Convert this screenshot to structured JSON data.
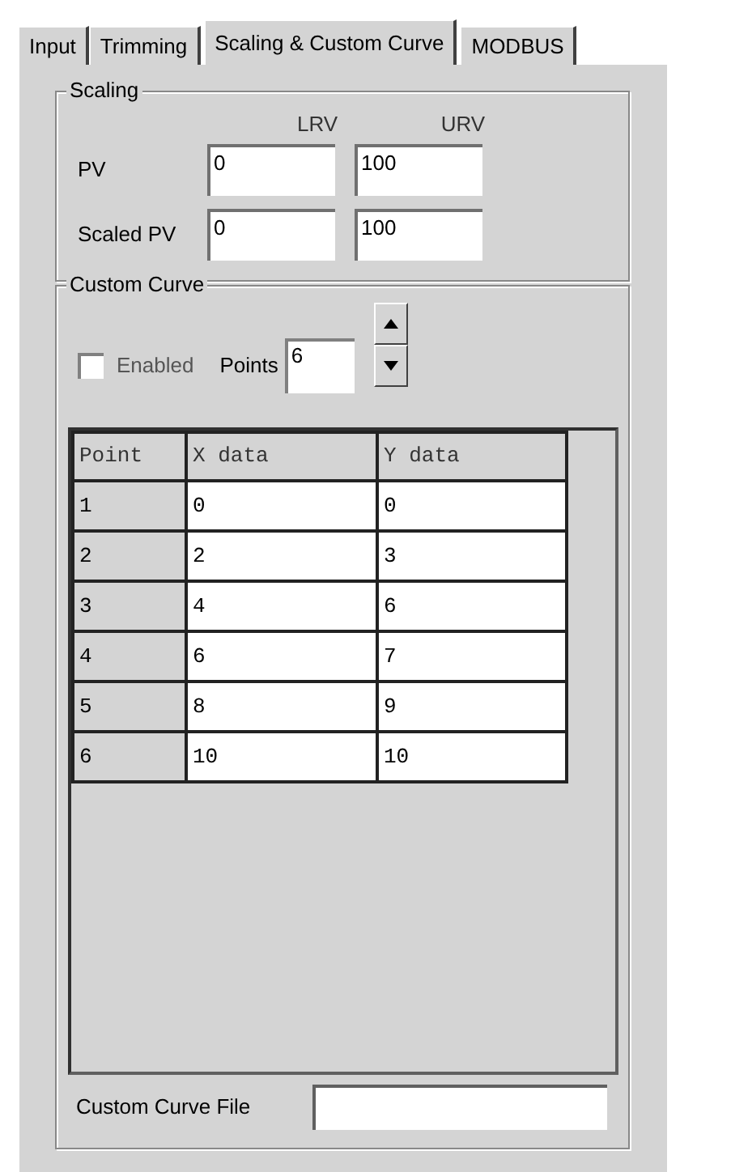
{
  "tabs": [
    {
      "label": "Input",
      "selected": false
    },
    {
      "label": "Trimming",
      "selected": false
    },
    {
      "label": "Scaling & Custom Curve",
      "selected": true
    },
    {
      "label": "MODBUS",
      "selected": false
    }
  ],
  "scaling": {
    "title": "Scaling",
    "columns": [
      "LRV",
      "URV"
    ],
    "rows": [
      {
        "label": "PV",
        "values": [
          "0",
          "100"
        ]
      },
      {
        "label": "Scaled PV",
        "values": [
          "0",
          "100"
        ]
      }
    ]
  },
  "custom_curve": {
    "title": "Custom Curve",
    "enabled": {
      "label": "Enabled",
      "checked": false
    },
    "points": {
      "label": "Points",
      "value": "6"
    },
    "table": {
      "columns": [
        "Point",
        "X data",
        "Y data"
      ],
      "rows": [
        [
          "1",
          "0",
          "0"
        ],
        [
          "2",
          "2",
          "3"
        ],
        [
          "3",
          "4",
          "6"
        ],
        [
          "4",
          "6",
          "7"
        ],
        [
          "5",
          "8",
          "9"
        ],
        [
          "6",
          "10",
          "10"
        ]
      ]
    },
    "file": {
      "label": "Custom Curve File"
    }
  }
}
